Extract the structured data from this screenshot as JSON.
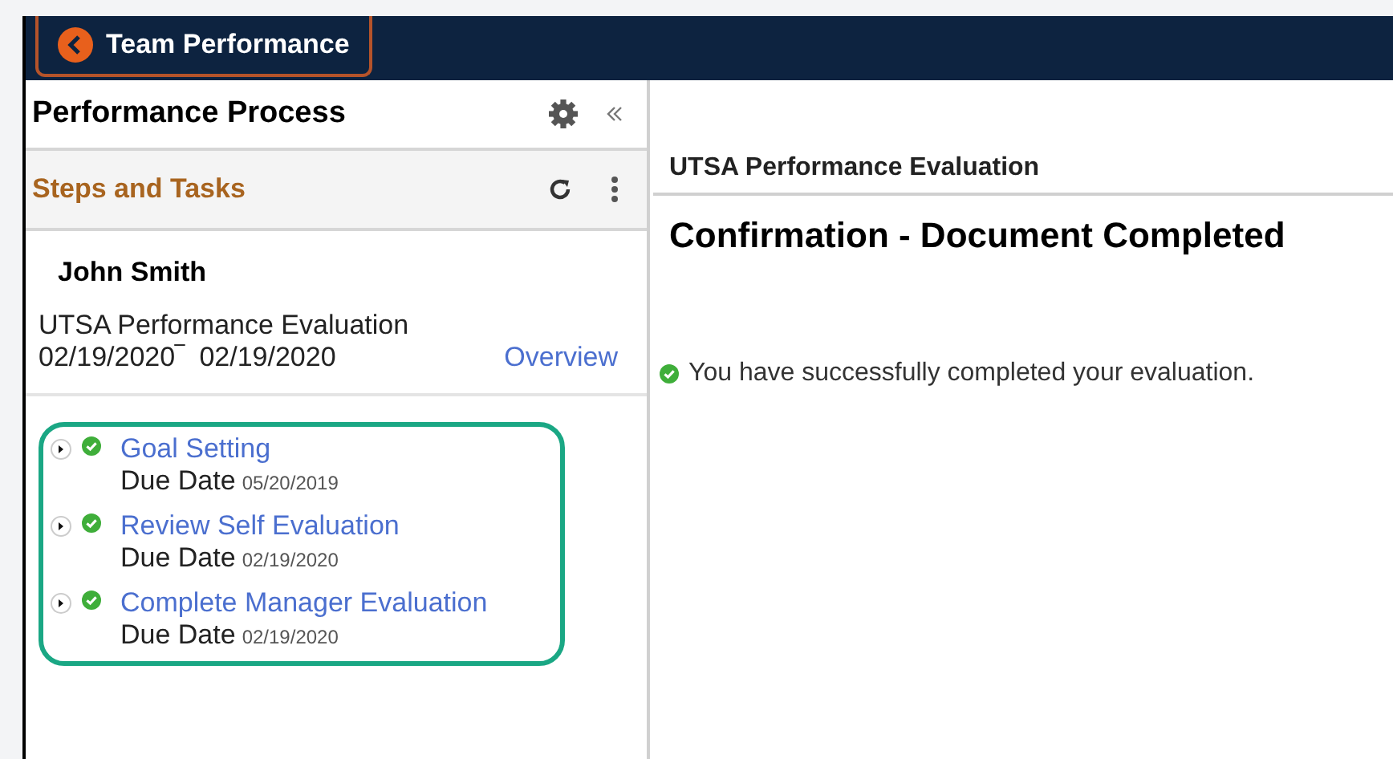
{
  "header": {
    "back_button": "Team Performance"
  },
  "sidebar": {
    "title": "Performance Process",
    "section_title": "Steps and Tasks",
    "employee": "John Smith",
    "document": "UTSA Performance Evaluation",
    "date_range": "02/19/2020‾  02/19/2020",
    "overview_link": "Overview",
    "steps": [
      {
        "name": "Goal Setting",
        "due_label": "Due Date",
        "due_date": "05/20/2019",
        "completed": true
      },
      {
        "name": "Review Self Evaluation",
        "due_label": "Due Date",
        "due_date": "02/19/2020",
        "completed": true
      },
      {
        "name": "Complete Manager Evaluation",
        "due_label": "Due Date",
        "due_date": "02/19/2020",
        "completed": true
      }
    ]
  },
  "main": {
    "subtitle": "UTSA Performance Evaluation",
    "title": "Confirmation - Document Completed",
    "message": "You have successfully completed your evaluation."
  }
}
